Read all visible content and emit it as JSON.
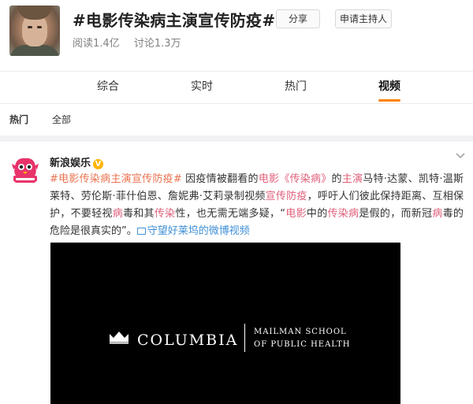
{
  "topic": {
    "title": "#电影传染病主演宣传防疫#",
    "reads": "阅读1.4亿",
    "discussions": "讨论1.3万",
    "share_label": "分享",
    "host_label": "申请主持人"
  },
  "tabs": [
    {
      "label": "综合"
    },
    {
      "label": "实时"
    },
    {
      "label": "热门"
    },
    {
      "label": "视频"
    }
  ],
  "active_tab": "视频",
  "subtabs": [
    {
      "label": "热门"
    },
    {
      "label": "全部"
    }
  ],
  "post": {
    "user": "新浪娱乐",
    "verified_mark": "V",
    "text": {
      "hashtag": "#电影传染病主演宣传防疫#",
      "t1": " 因疫情被翻看的",
      "k_movie": "电影",
      "k_book": "《传染病》",
      "t2": "的",
      "k_star": "主演",
      "t3": "马特·达蒙、凯特·温斯莱特、劳伦斯·菲什伯恩、詹妮弗·艾莉录制视频",
      "k_promo": "宣传防疫",
      "t4": "，呼吁人们彼此保持距离、互相保护，不要轻视",
      "k_virus": "病",
      "t5": "毒和其",
      "k_spread": "传染",
      "t6": "性，也无需无端多疑，“",
      "k_movie2": "电影",
      "t7": "中的",
      "k_disease": "传染病",
      "t8": "是假的，而新冠",
      "k_virus2": "病",
      "t9": "毒的危险是很真实的”。",
      "video_link": "守望好莱坞的微博视频"
    },
    "video": {
      "logo_text": "COLUMBIA",
      "school_line1": "MAILMAN SCHOOL",
      "school_line2": "OF PUBLIC HEALTH"
    }
  },
  "colors": {
    "accent": "#ff8200",
    "highlight": "#eb7350",
    "link": "#3e8fd6"
  }
}
